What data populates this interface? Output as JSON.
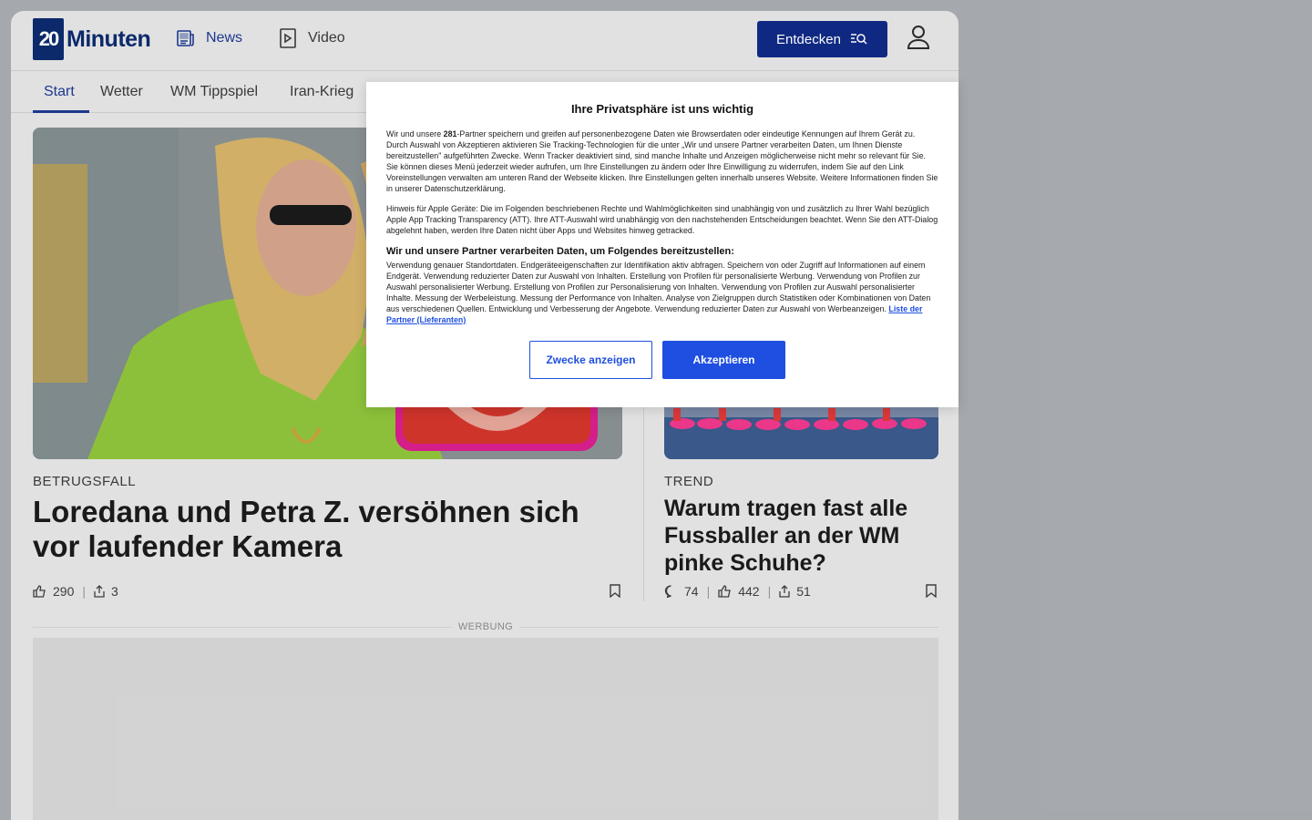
{
  "header": {
    "logo_number": "20",
    "logo_text": "Minuten",
    "nav_news": "News",
    "nav_video": "Video",
    "explore_label": "Entdecken"
  },
  "subnav": {
    "items": [
      "Start",
      "Wetter",
      "WM Tippspiel",
      "Iran-Krieg"
    ]
  },
  "articles": {
    "main": {
      "kicker": "BETRUGSFALL",
      "headline": "Loredana und Petra Z. versöhnen sich vor laufender Kamera",
      "likes": "290",
      "shares": "3"
    },
    "side": {
      "kicker": "TREND",
      "headline": "Warum tragen fast alle Fussballer an der WM pinke Schuhe?",
      "comments": "74",
      "likes": "442",
      "shares": "51"
    }
  },
  "ad": {
    "label": "WERBUNG"
  },
  "consent": {
    "title": "Ihre Privatsphäre ist uns wichtig",
    "p1_before": "Wir und unsere ",
    "p1_count": "281",
    "p1_after": "-Partner speichern und greifen auf personenbezogene Daten wie Browserdaten oder eindeutige Kennungen auf Ihrem Gerät zu. Durch Auswahl von Akzeptieren aktivieren Sie Tracking-Technologien für die unter „Wir und unsere Partner verarbeiten Daten, um Ihnen Dienste bereitzustellen\" aufgeführten Zwecke. Wenn Tracker deaktiviert sind, sind manche Inhalte und Anzeigen möglicherweise nicht mehr so relevant für Sie. Sie können dieses Menü jederzeit wieder aufrufen, um Ihre Einstellungen zu ändern oder Ihre Einwilligung zu widerrufen, indem Sie auf den Link Voreinstellungen verwalten am unteren Rand der Webseite klicken. Ihre Einstellungen gelten innerhalb unseres Website. Weitere Informationen finden Sie in unserer Datenschutzerklärung.",
    "p2": "Hinweis für Apple Geräte: Die im Folgenden beschriebenen Rechte und Wahlmöglichkeiten sind unabhängig von und zusätzlich zu Ihrer Wahl bezüglich Apple App Tracking Transparency (ATT). Ihre ATT-Auswahl wird unabhängig von den nachstehenden Entscheidungen beachtet. Wenn Sie den ATT-Dialog abgelehnt haben, werden Ihre Daten nicht über Apps und Websites hinweg getracked.",
    "subtitle": "Wir und unsere Partner verarbeiten Daten, um Folgendes bereitzustellen:",
    "p3": "Verwendung genauer Standortdaten. Endgeräteeigenschaften zur Identifikation aktiv abfragen. Speichern von oder Zugriff auf Informationen auf einem Endgerät. Verwendung reduzierter Daten zur Auswahl von Inhalten. Erstellung von Profilen für personalisierte Werbung. Verwendung von Profilen zur Auswahl personalisierter Werbung. Erstellung von Profilen zur Personalisierung von Inhalten. Verwendung von Profilen zur Auswahl personalisierter Inhalte. Messung der Werbeleistung. Messung der Performance von Inhalten. Analyse von Zielgruppen durch Statistiken oder Kombinationen von Daten aus verschiedenen Quellen. Entwicklung und Verbesserung der Angebote. Verwendung reduzierter Daten zur Auswahl von Werbeanzeigen. ",
    "partner_link": "Liste der Partner (Lieferanten)",
    "btn_purposes": "Zwecke anzeigen",
    "btn_accept": "Akzeptieren"
  },
  "colors": {
    "brand": "#0d2a6e",
    "accent": "#1f4fe0"
  }
}
